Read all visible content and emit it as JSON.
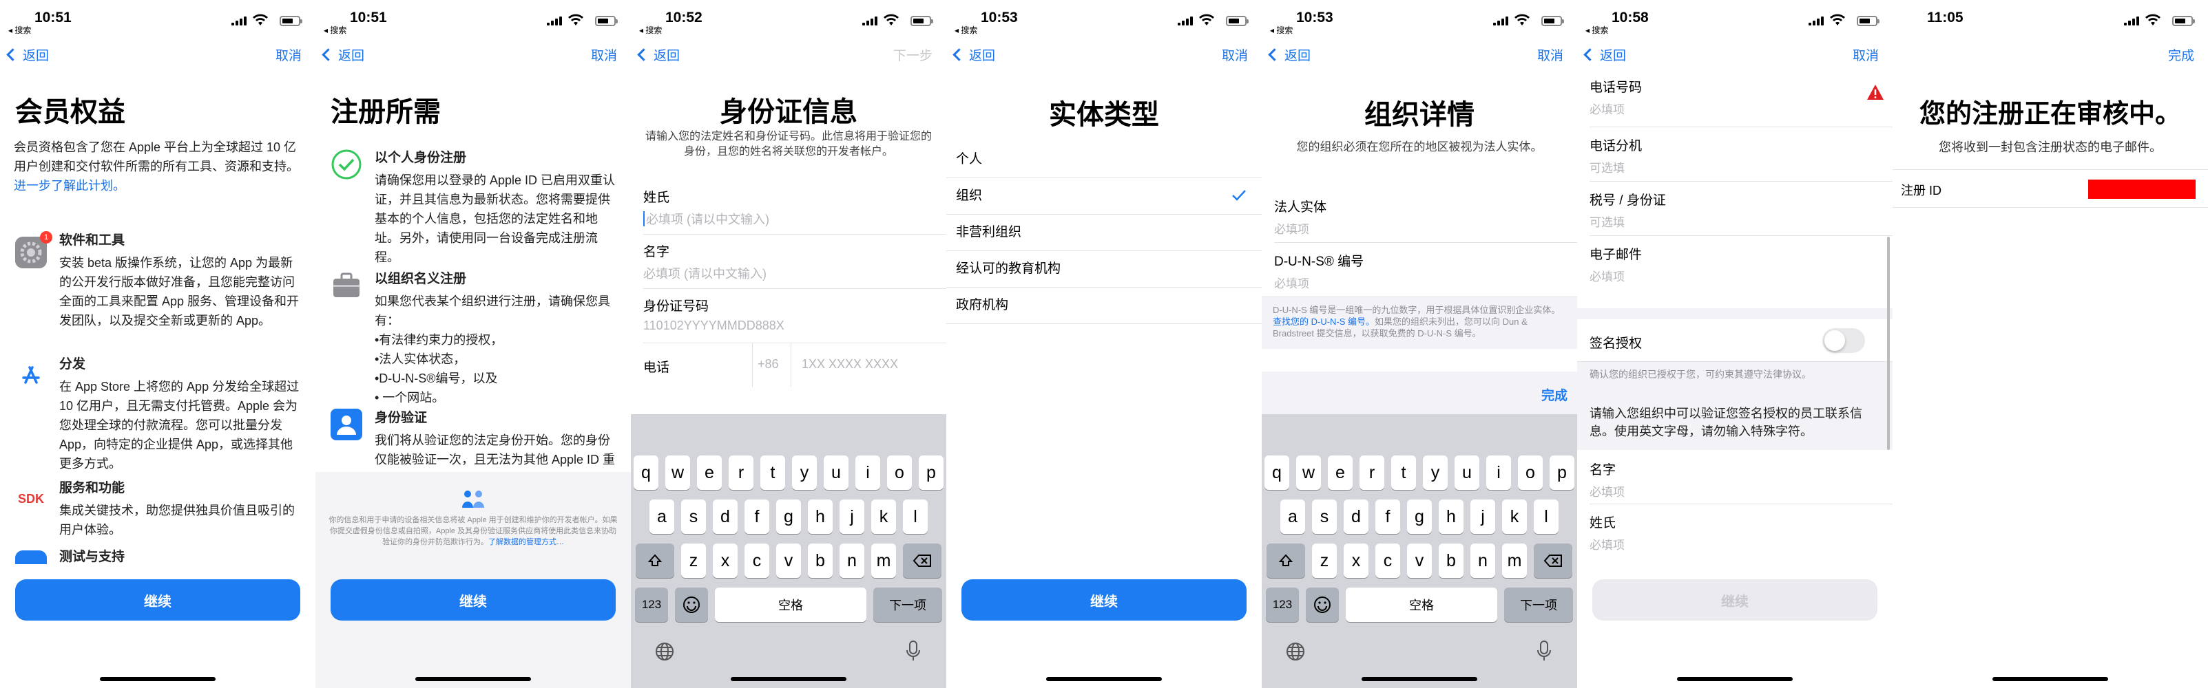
{
  "screens": [
    {
      "time": "10:51",
      "search": "◂ 搜索",
      "back": "返回",
      "right": "取消",
      "title": "会员权益",
      "intro": "会员资格包含了您在 Apple 平台上为全球超过 10 亿用户创建和交付软件所需的所有工具、资源和支持。",
      "learn": "进一步了解此计划。",
      "features": [
        {
          "title": "软件和工具",
          "text": "安装 beta 版操作系统，让您的 App 为最新的公开发行版本做好准备，且您能完整访问全面的工具来配置 App 服务、管理设备和开发团队，以及提交全新或更新的 App。",
          "icon": "settings-icon",
          "badge": "1"
        },
        {
          "title": "分发",
          "text": "在 App Store 上将您的 App 分发给全球超过 10 亿用户，且无需支付托管费。Apple 会为您处理全球的付款流程。您可以批量分发 App，向特定的企业提供 App，或选择其他更多方式。",
          "icon": "app-store-icon"
        },
        {
          "title": "服务和功能",
          "text": "集成关键技术，助您提供独具价值且吸引的用户体验。",
          "icon": "sdk-icon",
          "icon_text": "SDK"
        },
        {
          "title": "测试与支持",
          "text": "",
          "icon": "testflight-icon"
        }
      ],
      "button": "继续"
    },
    {
      "time": "10:51",
      "search": "◂ 搜索",
      "back": "返回",
      "right": "取消",
      "title": "注册所需",
      "items": [
        {
          "title": "以个人身份注册",
          "text": "请确保您用以登录的 Apple ID 已启用双重认证，并且其信息为最新状态。您将需要提供基本的个人信息，包括您的法定姓名和地址。另外，请使用同一台设备完成注册流程。",
          "icon": "checkmark-circle-icon"
        },
        {
          "title": "以组织名义注册",
          "text": "如果您代表某个组织进行注册，请确保您具有：\n•有法律约束力的授权，\n•法人实体状态，\n•D-U-N-S®编号，以及\n• 一个网站。",
          "icon": "briefcase-icon"
        },
        {
          "title": "身份验证",
          "text": "我们将从验证您的法定身份开始。您的身份仅能被验证一次，且无法为其他 Apple ID 重复验证。如果您需要使用",
          "icon": "person-id-icon"
        }
      ],
      "privacy": "你的信息和用于申请的设备相关信息将被 Apple 用于创建和维护你的开发者帐户。如果你提交虚假身份信息或自拍照，Apple 及其身份验证服务供应商将使用此类信息来协助验证你的身份并防范欺诈行为。",
      "privacy_link": "了解数据的管理方式…",
      "button": "继续"
    },
    {
      "time": "10:52",
      "search": "◂ 搜索",
      "back": "返回",
      "right": "下一步",
      "title": "身份证信息",
      "desc": "请输入您的法定姓名和身份证号码。此信息将用于验证您的身份，且您的姓名将关联您的开发者帐户。",
      "fields": [
        {
          "label": "姓氏",
          "placeholder": "必填项 (请以中文输入)"
        },
        {
          "label": "名字",
          "placeholder": "必填项 (请以中文输入)"
        },
        {
          "label": "身份证号码",
          "placeholder": "110102YYYYMMDD888X"
        }
      ],
      "phone_label": "电话",
      "phone_code": "+86",
      "phone_placeholder": "1XX XXXX XXXX",
      "kb": {
        "row1": [
          "q",
          "w",
          "e",
          "r",
          "t",
          "y",
          "u",
          "i",
          "o",
          "p"
        ],
        "row2": [
          "a",
          "s",
          "d",
          "f",
          "g",
          "h",
          "j",
          "k",
          "l"
        ],
        "row3": [
          "z",
          "x",
          "c",
          "v",
          "b",
          "n",
          "m"
        ],
        "num": "123",
        "space": "空格",
        "next": "下一项"
      }
    },
    {
      "time": "10:53",
      "search": "◂ 搜索",
      "back": "返回",
      "right": "取消",
      "title": "实体类型",
      "options": [
        "个人",
        "组织",
        "非营利组织",
        "经认可的教育机构",
        "政府机构"
      ],
      "selected_index": 1,
      "button": "继续"
    },
    {
      "time": "10:53",
      "search": "◂ 搜索",
      "back": "返回",
      "right": "取消",
      "title": "组织详情",
      "desc": "您的组织必须在您所在的地区被视为法人实体。",
      "fields": [
        {
          "label": "法人实体",
          "placeholder": "必填项"
        },
        {
          "label": "D-U-N-S® 编号",
          "placeholder": "必填项"
        }
      ],
      "duns_note": "D-U-N-S 编号是一组唯一的九位数字，用于根据具体位置识别企业实体。",
      "duns_link": "查找您的 D-U-N-S 编号。",
      "duns_note2": "如果您的组织未列出，您可以向 Dun & Bradstreet 提交信息，以获取免费的 D-U-N-S 编号。",
      "done": "完成",
      "kb": {
        "row1": [
          "q",
          "w",
          "e",
          "r",
          "t",
          "y",
          "u",
          "i",
          "o",
          "p"
        ],
        "row2": [
          "a",
          "s",
          "d",
          "f",
          "g",
          "h",
          "j",
          "k",
          "l"
        ],
        "row3": [
          "z",
          "x",
          "c",
          "v",
          "b",
          "n",
          "m"
        ],
        "num": "123",
        "space": "空格",
        "next": "下一项"
      }
    },
    {
      "time": "10:58",
      "search": "◂ 搜索",
      "back": "返回",
      "right": "取消",
      "fields": [
        {
          "label": "电话号码",
          "placeholder": "必填项"
        },
        {
          "label": "电话分机",
          "placeholder": "可选填"
        },
        {
          "label": "税号 / 身份证",
          "placeholder": "可选填"
        },
        {
          "label": "电子邮件",
          "placeholder": "必填项"
        }
      ],
      "sign_label": "签名授权",
      "sign_note": "确认您的组织已授权于您，可约束其遵守法律协议。",
      "contact_note": "请输入您组织中可以验证您签名授权的员工联系信息。使用英文字母，请勿输入特殊字符。",
      "fields2": [
        {
          "label": "名字",
          "placeholder": "必填项"
        },
        {
          "label": "姓氏",
          "placeholder": "必填项"
        }
      ],
      "button": "继续"
    },
    {
      "time": "11:05",
      "right": "完成",
      "title": "您的注册正在审核中。",
      "desc": "您将收到一封包含注册状态的电子邮件。",
      "id_label": "注册 ID"
    }
  ],
  "colors": {
    "accent": "#1d7cf2",
    "link": "#1a73e8",
    "redacted": "#ff0000",
    "warning": "#e02020"
  }
}
